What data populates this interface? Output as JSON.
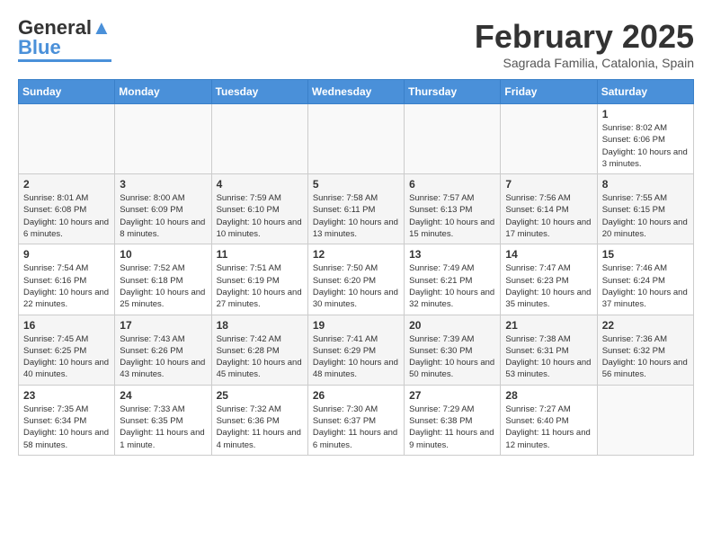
{
  "header": {
    "logo_general": "General",
    "logo_blue": "Blue",
    "month_title": "February 2025",
    "location": "Sagrada Familia, Catalonia, Spain"
  },
  "weekdays": [
    "Sunday",
    "Monday",
    "Tuesday",
    "Wednesday",
    "Thursday",
    "Friday",
    "Saturday"
  ],
  "weeks": [
    [
      {
        "day": "",
        "info": ""
      },
      {
        "day": "",
        "info": ""
      },
      {
        "day": "",
        "info": ""
      },
      {
        "day": "",
        "info": ""
      },
      {
        "day": "",
        "info": ""
      },
      {
        "day": "",
        "info": ""
      },
      {
        "day": "1",
        "info": "Sunrise: 8:02 AM\nSunset: 6:06 PM\nDaylight: 10 hours and 3 minutes."
      }
    ],
    [
      {
        "day": "2",
        "info": "Sunrise: 8:01 AM\nSunset: 6:08 PM\nDaylight: 10 hours and 6 minutes."
      },
      {
        "day": "3",
        "info": "Sunrise: 8:00 AM\nSunset: 6:09 PM\nDaylight: 10 hours and 8 minutes."
      },
      {
        "day": "4",
        "info": "Sunrise: 7:59 AM\nSunset: 6:10 PM\nDaylight: 10 hours and 10 minutes."
      },
      {
        "day": "5",
        "info": "Sunrise: 7:58 AM\nSunset: 6:11 PM\nDaylight: 10 hours and 13 minutes."
      },
      {
        "day": "6",
        "info": "Sunrise: 7:57 AM\nSunset: 6:13 PM\nDaylight: 10 hours and 15 minutes."
      },
      {
        "day": "7",
        "info": "Sunrise: 7:56 AM\nSunset: 6:14 PM\nDaylight: 10 hours and 17 minutes."
      },
      {
        "day": "8",
        "info": "Sunrise: 7:55 AM\nSunset: 6:15 PM\nDaylight: 10 hours and 20 minutes."
      }
    ],
    [
      {
        "day": "9",
        "info": "Sunrise: 7:54 AM\nSunset: 6:16 PM\nDaylight: 10 hours and 22 minutes."
      },
      {
        "day": "10",
        "info": "Sunrise: 7:52 AM\nSunset: 6:18 PM\nDaylight: 10 hours and 25 minutes."
      },
      {
        "day": "11",
        "info": "Sunrise: 7:51 AM\nSunset: 6:19 PM\nDaylight: 10 hours and 27 minutes."
      },
      {
        "day": "12",
        "info": "Sunrise: 7:50 AM\nSunset: 6:20 PM\nDaylight: 10 hours and 30 minutes."
      },
      {
        "day": "13",
        "info": "Sunrise: 7:49 AM\nSunset: 6:21 PM\nDaylight: 10 hours and 32 minutes."
      },
      {
        "day": "14",
        "info": "Sunrise: 7:47 AM\nSunset: 6:23 PM\nDaylight: 10 hours and 35 minutes."
      },
      {
        "day": "15",
        "info": "Sunrise: 7:46 AM\nSunset: 6:24 PM\nDaylight: 10 hours and 37 minutes."
      }
    ],
    [
      {
        "day": "16",
        "info": "Sunrise: 7:45 AM\nSunset: 6:25 PM\nDaylight: 10 hours and 40 minutes."
      },
      {
        "day": "17",
        "info": "Sunrise: 7:43 AM\nSunset: 6:26 PM\nDaylight: 10 hours and 43 minutes."
      },
      {
        "day": "18",
        "info": "Sunrise: 7:42 AM\nSunset: 6:28 PM\nDaylight: 10 hours and 45 minutes."
      },
      {
        "day": "19",
        "info": "Sunrise: 7:41 AM\nSunset: 6:29 PM\nDaylight: 10 hours and 48 minutes."
      },
      {
        "day": "20",
        "info": "Sunrise: 7:39 AM\nSunset: 6:30 PM\nDaylight: 10 hours and 50 minutes."
      },
      {
        "day": "21",
        "info": "Sunrise: 7:38 AM\nSunset: 6:31 PM\nDaylight: 10 hours and 53 minutes."
      },
      {
        "day": "22",
        "info": "Sunrise: 7:36 AM\nSunset: 6:32 PM\nDaylight: 10 hours and 56 minutes."
      }
    ],
    [
      {
        "day": "23",
        "info": "Sunrise: 7:35 AM\nSunset: 6:34 PM\nDaylight: 10 hours and 58 minutes."
      },
      {
        "day": "24",
        "info": "Sunrise: 7:33 AM\nSunset: 6:35 PM\nDaylight: 11 hours and 1 minute."
      },
      {
        "day": "25",
        "info": "Sunrise: 7:32 AM\nSunset: 6:36 PM\nDaylight: 11 hours and 4 minutes."
      },
      {
        "day": "26",
        "info": "Sunrise: 7:30 AM\nSunset: 6:37 PM\nDaylight: 11 hours and 6 minutes."
      },
      {
        "day": "27",
        "info": "Sunrise: 7:29 AM\nSunset: 6:38 PM\nDaylight: 11 hours and 9 minutes."
      },
      {
        "day": "28",
        "info": "Sunrise: 7:27 AM\nSunset: 6:40 PM\nDaylight: 11 hours and 12 minutes."
      },
      {
        "day": "",
        "info": ""
      }
    ]
  ]
}
